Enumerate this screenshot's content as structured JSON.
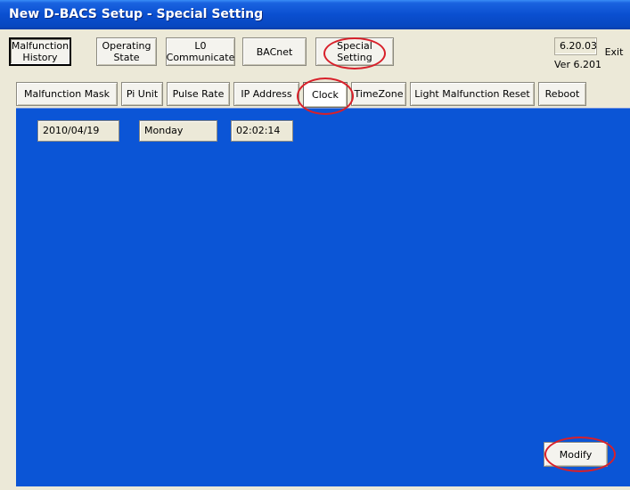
{
  "window": {
    "title": "New D-BACS Setup - Special Setting"
  },
  "toolbar": {
    "malfunction_history": "Malfunction\nHistory",
    "operating_state": "Operating\nState",
    "lo_communicate": "L0\nCommunicate",
    "bacnet": "BACnet",
    "special_setting": "Special\nSetting",
    "version_box": "6.20.03",
    "version_label": "Ver 6.201",
    "exit": "Exit"
  },
  "tabs": [
    {
      "label": "Malfunction Mask"
    },
    {
      "label": "Pi Unit"
    },
    {
      "label": "Pulse Rate"
    },
    {
      "label": "IP Address"
    },
    {
      "label": "Clock"
    },
    {
      "label": "TimeZone"
    },
    {
      "label": "Light Malfunction Reset"
    },
    {
      "label": "Reboot"
    }
  ],
  "clock": {
    "date": "2010/04/19",
    "weekday": "Monday",
    "time": "02:02:14"
  },
  "actions": {
    "modify": "Modify"
  },
  "colors": {
    "titlebar": "#0a4fd0",
    "panel": "#0b55d6",
    "window": "#ece9d8",
    "highlight_ring": "#d8202a"
  }
}
